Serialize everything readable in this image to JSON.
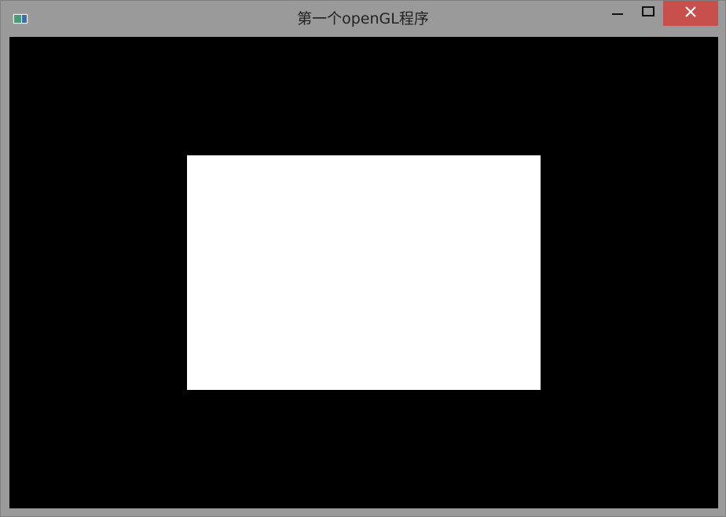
{
  "window": {
    "title": "第一个openGL程序",
    "icons": {
      "app": "app-window-icon",
      "minimize": "minimize-icon",
      "maximize": "maximize-icon",
      "close": "close-icon"
    },
    "colors": {
      "frame": "#9a9a9a",
      "close_button": "#c7504c",
      "viewport_background": "#000000",
      "rectangle_fill": "#ffffff"
    }
  }
}
